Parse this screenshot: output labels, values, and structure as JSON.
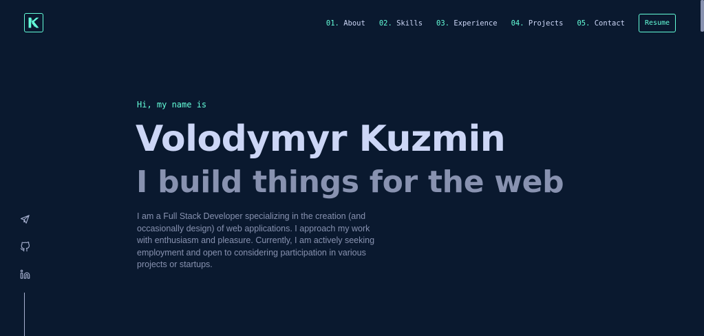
{
  "logo": {
    "icon": "logo-k-icon",
    "color": "#64ffda"
  },
  "nav": {
    "items": [
      {
        "num": "01.",
        "label": "About"
      },
      {
        "num": "02.",
        "label": "Skills"
      },
      {
        "num": "03.",
        "label": "Experience"
      },
      {
        "num": "04.",
        "label": "Projects"
      },
      {
        "num": "05.",
        "label": "Contact"
      }
    ],
    "resume_label": "Resume"
  },
  "hero": {
    "greeting": "Hi, my name is",
    "name": "Volodymyr Kuzmin",
    "tagline": "I build things for the web",
    "bio": "I am a Full Stack Developer specializing in the creation (and occasionally design) of web applications. I approach my work with enthusiasm and pleasure. Currently, I am actively seeking employment and open to considering participation in various projects or startups."
  },
  "social": {
    "links": [
      {
        "icon": "telegram-icon"
      },
      {
        "icon": "github-icon"
      },
      {
        "icon": "linkedin-icon"
      }
    ]
  },
  "colors": {
    "background": "#0a192f",
    "accent": "#64ffda",
    "heading": "#ccd6f6",
    "text": "#8892b0"
  }
}
